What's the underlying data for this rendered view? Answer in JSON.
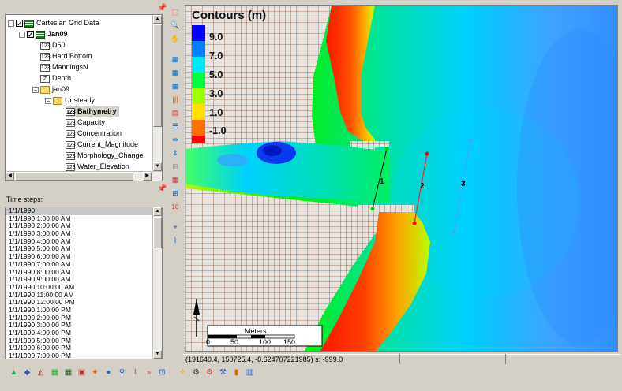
{
  "tree": {
    "items": [
      {
        "label": "Cartesian Grid Data",
        "icon": "grid-folder-icon"
      },
      {
        "label": "Jan09",
        "icon": "grid-icon"
      },
      {
        "label": "D50",
        "icon": "numeric-dataset-icon"
      },
      {
        "label": "Hard Bottom",
        "icon": "numeric-dataset-icon"
      },
      {
        "label": "ManningsN",
        "icon": "numeric-dataset-icon"
      },
      {
        "label": "Depth",
        "icon": "z-dataset-icon"
      },
      {
        "label": "jan09",
        "icon": "folder-icon"
      },
      {
        "label": "Unsteady",
        "icon": "folder-icon"
      },
      {
        "label": "Bathymetry",
        "icon": "numeric-dataset-icon"
      },
      {
        "label": "Capacity",
        "icon": "numeric-dataset-icon"
      },
      {
        "label": "Concentration",
        "icon": "numeric-dataset-icon"
      },
      {
        "label": "Current_Magnitude",
        "icon": "numeric-dataset-icon"
      },
      {
        "label": "Morphology_Change",
        "icon": "numeric-dataset-icon"
      },
      {
        "label": "Water_Elevation",
        "icon": "numeric-dataset-icon"
      }
    ],
    "icon_text": {
      "numeric": "123",
      "z": "Z"
    }
  },
  "time_steps": {
    "label": "Time steps:",
    "items": [
      "1/1/1990",
      "1/1/1990 1:00:00 AM",
      "1/1/1990 2:00:00 AM",
      "1/1/1990 3:00:00 AM",
      "1/1/1990 4:00:00 AM",
      "1/1/1990 5:00:00 AM",
      "1/1/1990 6:00:00 AM",
      "1/1/1990 7:00:00 AM",
      "1/1/1990 8:00:00 AM",
      "1/1/1990 9:00:00 AM",
      "1/1/1990 10:00:00 AM",
      "1/1/1990 11:00:00 AM",
      "1/1/1990 12:00:00 PM",
      "1/1/1990 1:00:00 PM",
      "1/1/1990 2:00:00 PM",
      "1/1/1990 3:00:00 PM",
      "1/1/1990 4:00:00 PM",
      "1/1/1990 5:00:00 PM",
      "1/1/1990 6:00:00 PM",
      "1/1/1990 7:00:00 PM"
    ]
  },
  "legend": {
    "title": "Contours (m)",
    "labels": [
      "9.0",
      "7.0",
      "5.0",
      "3.0",
      "1.0",
      "-1.0"
    ],
    "colors": [
      "#0000ff",
      "#0080ff",
      "#00ffff",
      "#00ff40",
      "#80ff00",
      "#ffff00",
      "#ff8000",
      "#ff0000"
    ]
  },
  "annotations": {
    "line1": "1",
    "line2": "2",
    "line3": "3"
  },
  "scale_bar": {
    "title": "Meters",
    "ticks": [
      "0",
      "50",
      "100",
      "150"
    ]
  },
  "status": {
    "coords": "(191640.4, 150725.4, -8.624707221985) s: -999.0"
  }
}
